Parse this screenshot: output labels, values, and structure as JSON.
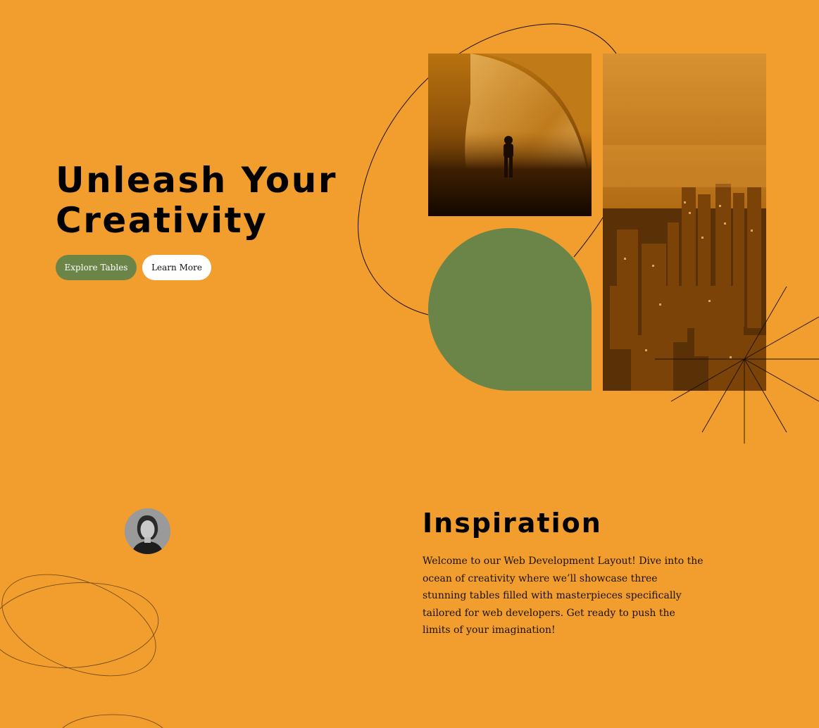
{
  "hero": {
    "title_line1": "Unleash Your",
    "title_line2": "Creativity",
    "primary_button": "Explore Tables",
    "secondary_button": "Learn More"
  },
  "inspiration": {
    "title": "Inspiration",
    "text": "Welcome to our Web Development Layout! Dive into the ocean of creativity where we’ll showcase three stunning tables filled with masterpieces specifically tailored for web developers. Get ready to push the limits of your imagination!"
  },
  "colors": {
    "background": "#F29E2E",
    "accent_green": "#6B8448",
    "text": "#000000"
  },
  "icons": {
    "astronaut_image": "astronaut-planet-image",
    "city_image": "city-skyline-image",
    "avatar": "person-portrait-avatar"
  }
}
